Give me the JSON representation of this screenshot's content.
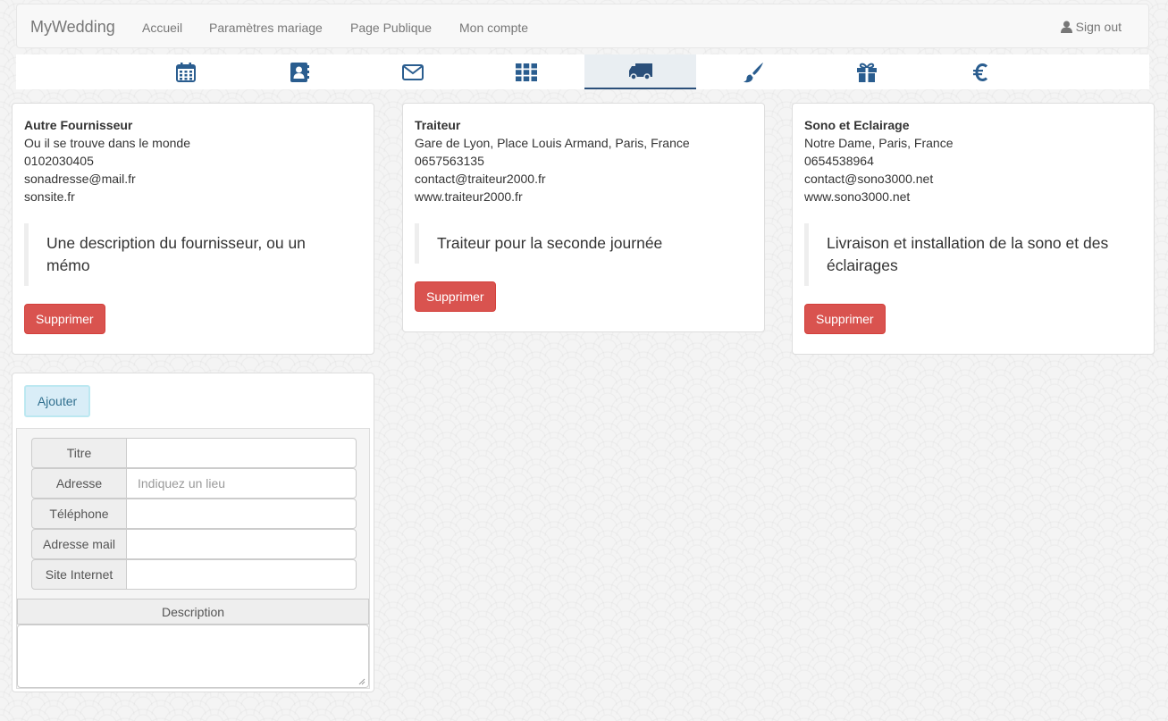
{
  "navbar": {
    "brand": "MyWedding",
    "links": [
      "Accueil",
      "Paramètres mariage",
      "Page Publique",
      "Mon compte"
    ],
    "signout": "Sign out"
  },
  "iconbar": {
    "tabs": [
      "calendar-icon",
      "contact-book-icon",
      "envelope-icon",
      "grid-icon",
      "truck-icon",
      "paintbrush-icon",
      "gift-icon",
      "euro-icon"
    ],
    "active": "truck-icon",
    "accent_color": "#2a5d8f"
  },
  "suppliers": [
    {
      "title": "Autre Fournisseur",
      "address": "Ou il se trouve dans le monde",
      "phone": "0102030405",
      "email": "sonadresse@mail.fr",
      "website": "sonsite.fr",
      "description": "Une description du fournisseur, ou un mémo",
      "delete_label": "Supprimer"
    },
    {
      "title": "Traiteur",
      "address": "Gare de Lyon, Place Louis Armand, Paris, France",
      "phone": "0657563135",
      "email": "contact@traiteur2000.fr",
      "website": "www.traiteur2000.fr",
      "description": "Traiteur pour la seconde journée",
      "delete_label": "Supprimer"
    },
    {
      "title": "Sono et Eclairage",
      "address": "Notre Dame, Paris, France",
      "phone": "0654538964",
      "email": "contact@sono3000.net",
      "website": "www.sono3000.net",
      "description": "Livraison et installation de la sono et des éclairages",
      "delete_label": "Supprimer"
    }
  ],
  "form": {
    "add_label": "Ajouter",
    "fields": [
      {
        "label": "Titre",
        "value": "",
        "placeholder": ""
      },
      {
        "label": "Adresse",
        "value": "",
        "placeholder": "Indiquez un lieu"
      },
      {
        "label": "Téléphone",
        "value": "",
        "placeholder": ""
      },
      {
        "label": "Adresse mail",
        "value": "",
        "placeholder": ""
      },
      {
        "label": "Site Internet",
        "value": "",
        "placeholder": ""
      }
    ],
    "description_label": "Description",
    "description_value": ""
  },
  "colors": {
    "danger": "#d9534f",
    "info_bg": "#d9edf7",
    "info_text": "#31708f"
  }
}
